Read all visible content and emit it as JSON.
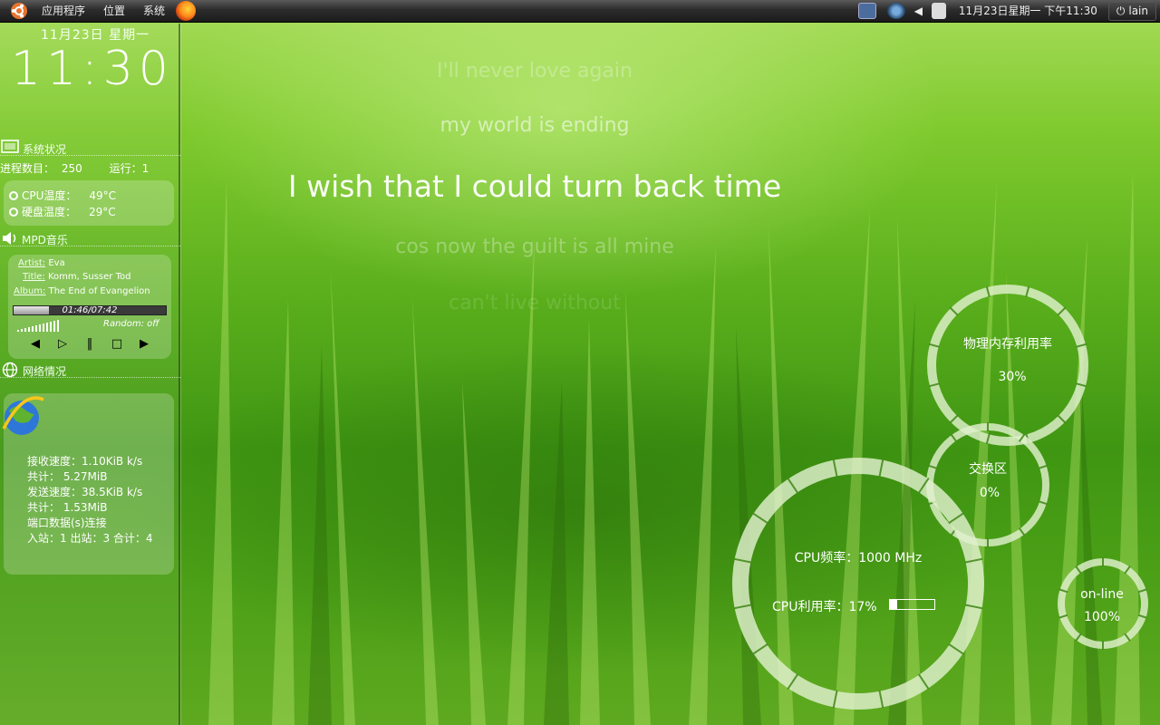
{
  "top_panel": {
    "menu": [
      "应用程序",
      "位置",
      "系统"
    ],
    "datetime": "11月23日星期一 下午11:30",
    "user": "lain"
  },
  "sidebar": {
    "date": "11月23日 星期一",
    "time": "11:30",
    "system": {
      "title": "系统状况",
      "processes_label": "进程数目：",
      "processes": "250",
      "running_label": "运行：",
      "running": "1",
      "cpu_temp_label": "CPU温度：",
      "cpu_temp": "49°C",
      "disk_temp_label": "硬盘温度：",
      "disk_temp": "29°C"
    },
    "mpd": {
      "title": "MPD音乐",
      "artist_label": "Artist:",
      "artist": "Eva",
      "title_label": "Title:",
      "song_title": "Komm, Susser Tod",
      "album_label": "Album:",
      "album": "The End of Evangelion",
      "elapsed": "01:46/07:42",
      "progress": 0.23,
      "random": "Random: off"
    },
    "network": {
      "title": "网络情况",
      "lines": [
        "接收速度：1.10KiB k/s",
        "共计： 5.27MiB",
        "发送速度：38.5KiB k/s",
        "共计： 1.53MiB",
        "端口数据(s)连接",
        "入站：1  出站：3  合计：4"
      ]
    }
  },
  "lyrics": [
    "I'll never love again",
    "my world is ending",
    "I wish that I could turn back time",
    "cos now the guilt is all mine",
    "can't live without"
  ],
  "gauges": {
    "memory": {
      "label": "物理内存利用率",
      "value": "30%"
    },
    "swap": {
      "label": "交换区",
      "value": "0%"
    },
    "cpu_freq": "CPU频率：1000 MHz",
    "cpu_usage_label": "CPU利用率：17%",
    "cpu_usage": 0.17,
    "online": {
      "label": "on-line",
      "value": "100%"
    }
  }
}
